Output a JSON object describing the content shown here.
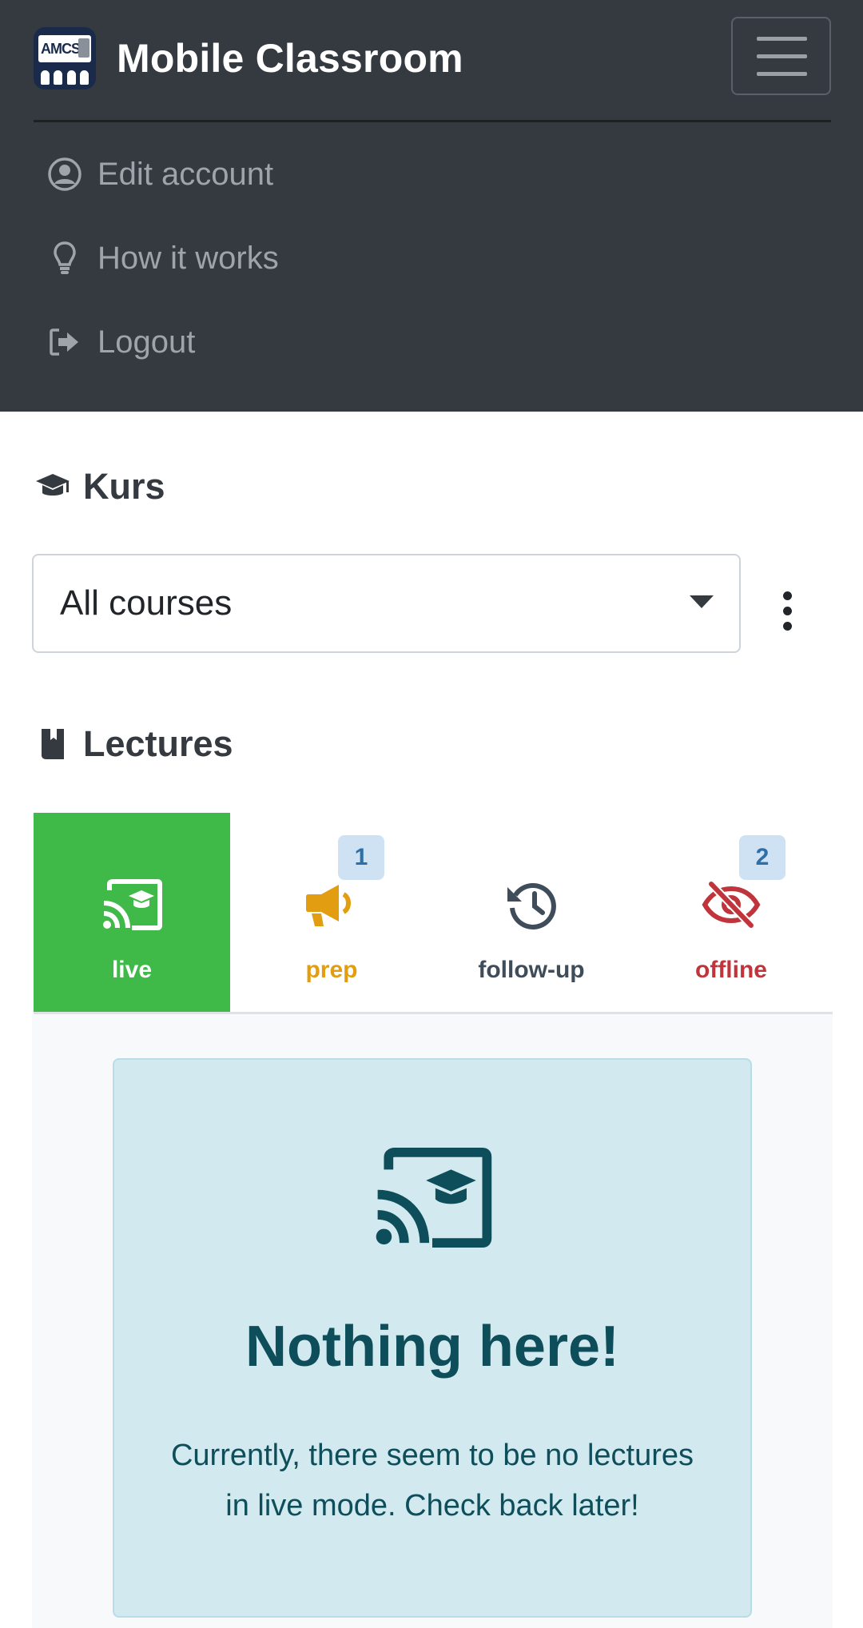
{
  "navbar": {
    "brand_title": "Mobile Classroom",
    "logo_text": "AMCS",
    "logo_icon": "amcs-logo",
    "menu_icon": "hamburger-menu-icon",
    "items": [
      {
        "label": "Edit account",
        "icon": "user-circle-icon"
      },
      {
        "label": "How it works",
        "icon": "lightbulb-icon"
      },
      {
        "label": "Logout",
        "icon": "sign-out-icon"
      }
    ]
  },
  "course_section": {
    "title": "Kurs",
    "icon": "graduation-cap-icon",
    "select_value": "All courses",
    "more_icon": "kebab-menu-icon"
  },
  "lectures_section": {
    "title": "Lectures",
    "icon": "book-icon",
    "tabs": [
      {
        "label": "live",
        "icon": "cast-graduation-icon",
        "active": true,
        "badge": null,
        "color": "#ffffff"
      },
      {
        "label": "prep",
        "icon": "megaphone-icon",
        "active": false,
        "badge": "1",
        "color": "#e29e10"
      },
      {
        "label": "follow-up",
        "icon": "history-icon",
        "active": false,
        "badge": null,
        "color": "#3f4d5a"
      },
      {
        "label": "offline",
        "icon": "eye-slash-icon",
        "active": false,
        "badge": "2",
        "color": "#c0353c"
      }
    ]
  },
  "empty_state": {
    "icon": "cast-graduation-icon",
    "title": "Nothing here!",
    "message": "Currently, there seem to be no lectures in live mode. Check back later!"
  },
  "colors": {
    "navbar_bg": "#343a40",
    "active_tab": "#3fb948",
    "alert_bg": "#d1e9ef",
    "alert_text": "#0e4e5a",
    "badge_bg": "#cfe2f3"
  }
}
